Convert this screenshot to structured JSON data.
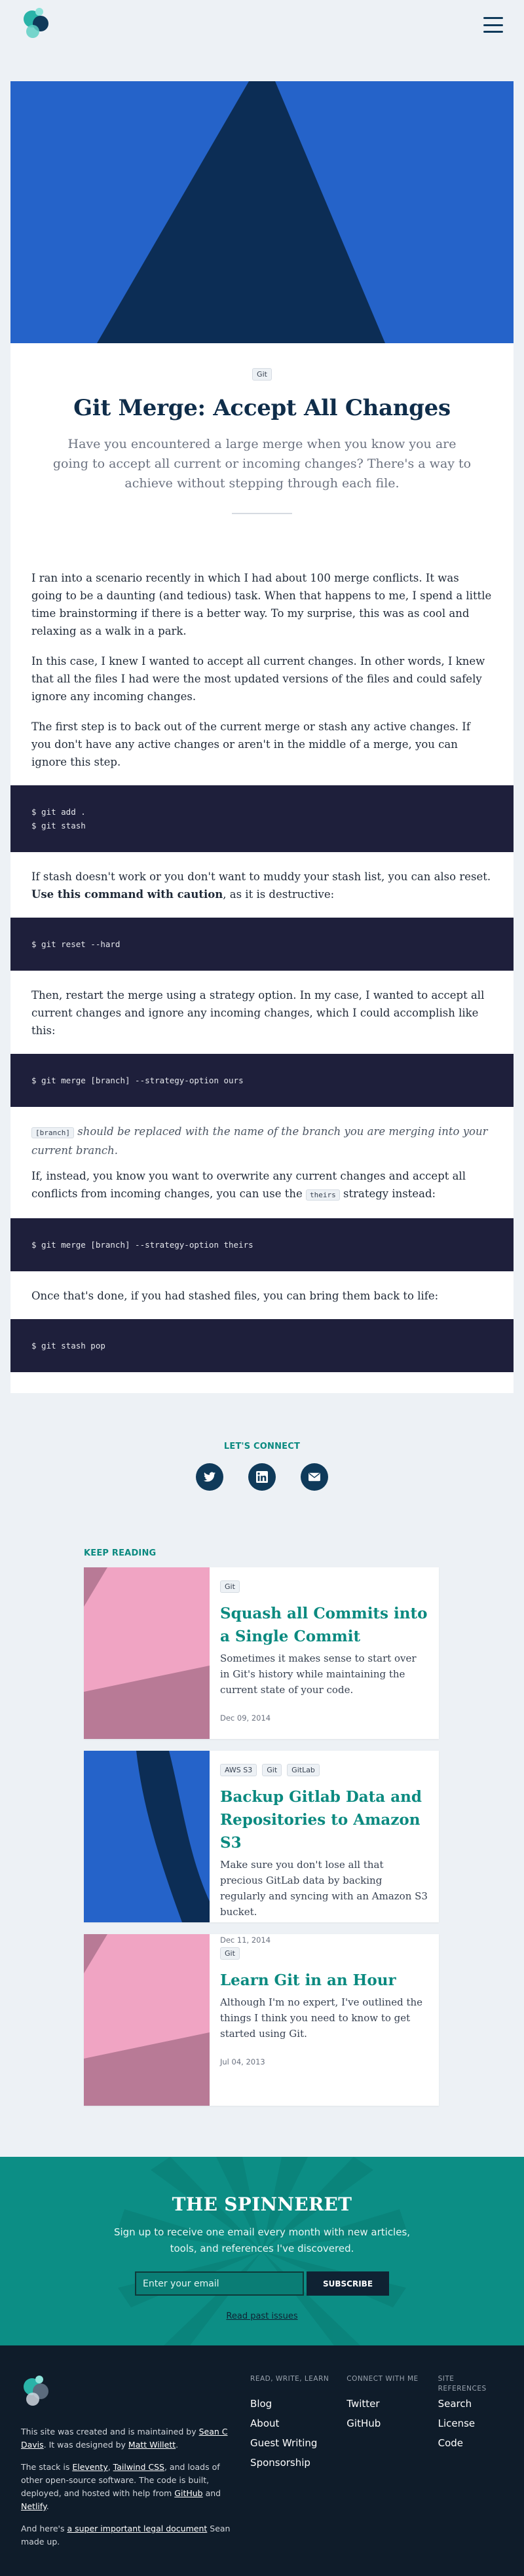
{
  "article": {
    "tag": "Git",
    "title": "Git Merge: Accept All Changes",
    "subtitle": "Have you encountered a large merge when you know you are going to accept all current or incoming changes? There's a way to achieve without stepping through each file.",
    "p1": "I ran into a scenario recently in which I had about 100 merge conflicts. It was going to be a daunting (and tedious) task. When that happens to me, I spend a little time brainstorming if there is a better way. To my surprise, this was as cool and relaxing as a walk in a park.",
    "p2": "In this case, I knew I wanted to accept all current changes. In other words, I knew that all the files I had were the most updated versions of the files and could safely ignore any incoming changes.",
    "p3": "The first step is to back out of the current merge or stash any active changes. If you don't have any active changes or aren't in the middle of a merge, you can ignore this step.",
    "code1": [
      "$ git add .",
      "$ git stash"
    ],
    "p4a": "If stash doesn't work or you don't want to muddy your stash list, you can also reset. ",
    "p4b": "Use this command with caution",
    "p4c": ", as it is destructive:",
    "code2": "$ git reset --hard",
    "p5": "Then, restart the merge using a strategy option. In my case, I wanted to accept all current changes and ignore any incoming changes, which I could accomplish like this:",
    "code3": "$ git merge [branch] --strategy-option ours",
    "note_code": "[branch]",
    "note_text": " should be replaced with the name of the branch you are merging into your current branch.",
    "p6a": "If, instead, you know you want to overwrite any current changes and accept all conflicts from incoming changes, you can use the ",
    "p6code": "theirs",
    "p6b": " strategy instead:",
    "code4": "$ git merge [branch] --strategy-option theirs",
    "p7": "Once that's done, if you had stashed files, you can bring them back to life:",
    "code5": "$ git stash pop"
  },
  "connect": {
    "label": "LET'S CONNECT",
    "icons": [
      "twitter-icon",
      "linkedin-icon",
      "email-icon"
    ]
  },
  "keep_reading": {
    "label": "KEEP READING",
    "cards": [
      {
        "tags": [
          "Git"
        ],
        "title": "Squash all Commits into a Single Commit",
        "desc": "Sometimes it makes sense to start over in Git's history while maintaining the current state of your code.",
        "date": "Dec 09, 2014"
      },
      {
        "tags": [
          "AWS S3",
          "Git",
          "GitLab"
        ],
        "title": "Backup Gitlab Data and Repositories to Amazon S3",
        "desc": "Make sure you don't lose all that precious GitLab data by backing regularly and syncing with an Amazon S3 bucket.",
        "date": "Dec 11, 2014"
      },
      {
        "tags": [
          "Git"
        ],
        "title": "Learn Git in an Hour",
        "desc": "Although I'm no expert, I've outlined the things I think you need to know to get started using Git.",
        "date": "Jul 04, 2013"
      }
    ]
  },
  "newsletter": {
    "title": "THE SPINNERET",
    "desc": "Sign up to receive one email every month with new articles, tools, and references I've discovered.",
    "placeholder": "Enter your email",
    "button": "SUBSCRIBE",
    "past": "Read past issues"
  },
  "footer": {
    "t1a": "This site was created and is maintained by ",
    "t1link": "Sean C Davis",
    "t1b": ". It was designed by ",
    "t1link2": "Matt Willett",
    "t1c": ".",
    "t2a": "The stack is ",
    "t2l1": "Eleventy",
    "t2b": ", ",
    "t2l2": "Tailwind CSS",
    "t2c": ", and loads of other open-source software. The code is built, deployed, and hosted with help from ",
    "t2l3": "GitHub",
    "t2d": " and ",
    "t2l4": "Netlify",
    "t2e": ".",
    "t3a": "And here's ",
    "t3l": "a super important legal document",
    "t3b": " Sean made up.",
    "cols": [
      {
        "head": "READ, WRITE, LEARN",
        "links": [
          "Blog",
          "About",
          "Guest Writing",
          "Sponsorship"
        ]
      },
      {
        "head": "CONNECT WITH ME",
        "links": [
          "Twitter",
          "GitHub"
        ]
      },
      {
        "head": "SITE REFERENCES",
        "links": [
          "Search",
          "License",
          "Code"
        ]
      }
    ]
  },
  "colors": {
    "accent": "#0b8a80",
    "navy": "#0f3a5a",
    "code_bg": "#1e1f3b",
    "hero_blue": "#2563c9"
  }
}
